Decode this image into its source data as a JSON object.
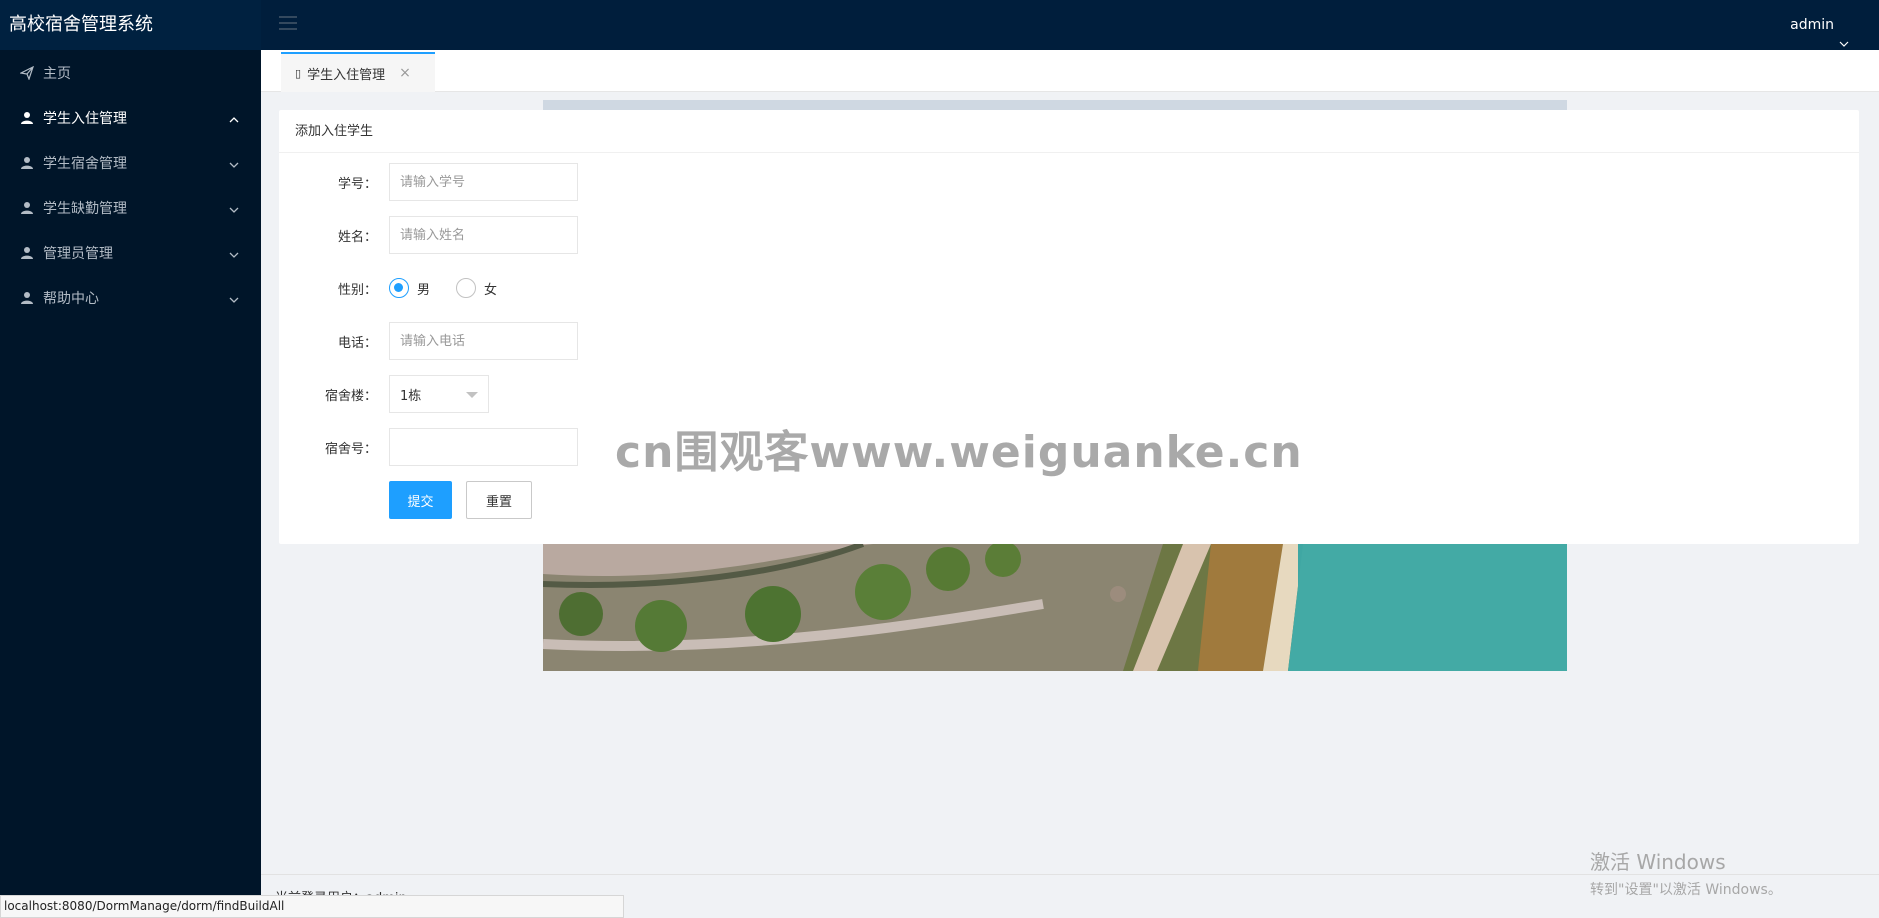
{
  "app": {
    "title": "高校宿舍管理系统",
    "accent_color": "#1e9fff",
    "sidebar_color": "#001529"
  },
  "sidebar": {
    "items": [
      {
        "label": "主页",
        "icon": "paper-plane-icon",
        "expanded": false,
        "has_arrow": false
      },
      {
        "label": "学生入住管理",
        "icon": "user-icon",
        "expanded": true,
        "has_arrow": true
      },
      {
        "label": "学生宿舍管理",
        "icon": "user-icon",
        "expanded": false,
        "has_arrow": true
      },
      {
        "label": "学生缺勤管理",
        "icon": "user-icon",
        "expanded": false,
        "has_arrow": true
      },
      {
        "label": "管理员管理",
        "icon": "user-icon",
        "expanded": false,
        "has_arrow": true
      },
      {
        "label": "帮助中心",
        "icon": "user-icon",
        "expanded": false,
        "has_arrow": true
      }
    ]
  },
  "header": {
    "user": "admin"
  },
  "tabs": [
    {
      "label": "学生入住管理",
      "close": "×"
    }
  ],
  "form": {
    "title": "添加入住学生",
    "student_id": {
      "label": "学号：",
      "placeholder": "请输入学号",
      "value": ""
    },
    "name": {
      "label": "姓名：",
      "placeholder": "请输入姓名",
      "value": ""
    },
    "gender": {
      "label": "性别：",
      "options": [
        "男",
        "女"
      ],
      "selected": "男"
    },
    "phone": {
      "label": "电话：",
      "placeholder": "请输入电话",
      "value": ""
    },
    "building": {
      "label": "宿舍楼：",
      "value": "1栋"
    },
    "room": {
      "label": "宿舍号：",
      "value": ""
    },
    "submit_label": "提交",
    "reset_label": "重置"
  },
  "watermark": "cn围观客www.weiguanke.cn",
  "footer": {
    "login_text": "当前登录用户：admin"
  },
  "status_bar": {
    "url": "localhost:8080/DormManage/dorm/findBuildAll"
  },
  "windows_activation": {
    "line1": "激活 Windows",
    "line2": "转到\"设置\"以激活 Windows。"
  }
}
